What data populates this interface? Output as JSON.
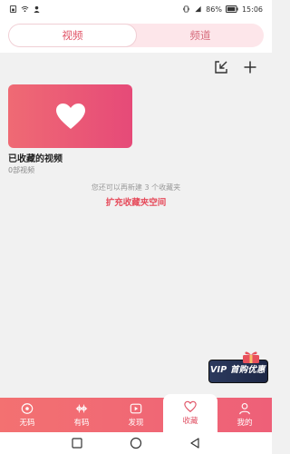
{
  "status_bar": {
    "battery_text": "86%",
    "time": "15:06"
  },
  "tabs": [
    {
      "label": "视频",
      "active": true
    },
    {
      "label": "频道",
      "active": false
    }
  ],
  "toolbar": {
    "icons": [
      "import-icon",
      "add-icon"
    ]
  },
  "collection": {
    "title": "已收藏的视频",
    "count": "0部视频",
    "hint": "您还可以再新建 3 个收藏夹",
    "expand_link": "扩充收藏夹空间"
  },
  "vip_promo": {
    "label": "VIP 首购优惠"
  },
  "bottom_nav": [
    {
      "label": "无码",
      "icon": "eye-icon",
      "active": false
    },
    {
      "label": "有码",
      "icon": "film-icon",
      "active": false
    },
    {
      "label": "发现",
      "icon": "video-icon",
      "active": false
    },
    {
      "label": "收藏",
      "icon": "heart-icon",
      "active": true
    },
    {
      "label": "我的",
      "icon": "user-icon",
      "active": false
    }
  ],
  "colors": {
    "accent": "#e05265",
    "nav_gradient_start": "#f37171",
    "nav_gradient_end": "#ee6078"
  }
}
